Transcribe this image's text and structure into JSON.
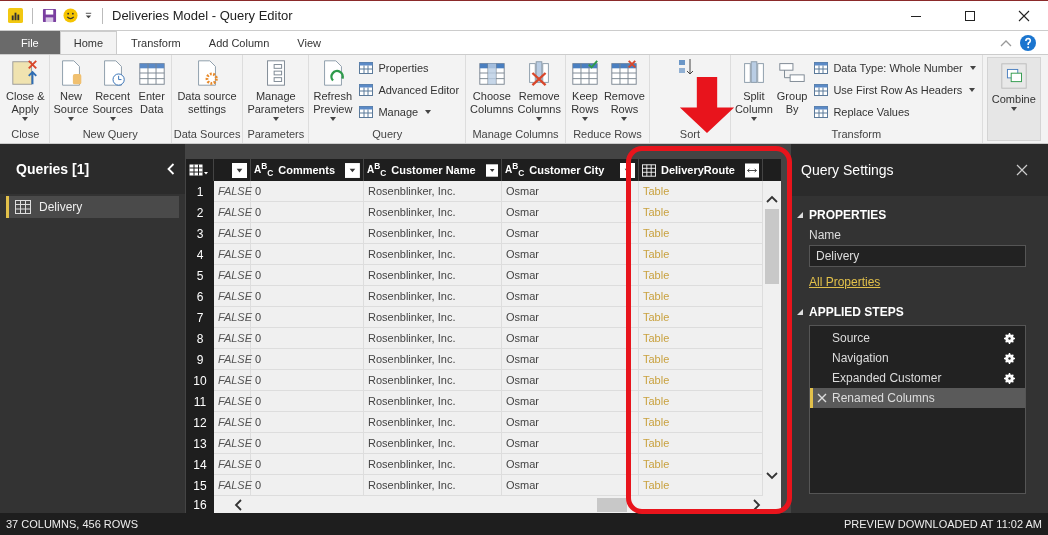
{
  "window": {
    "title": "Deliveries Model - Query Editor"
  },
  "tabs": [
    {
      "label": "File",
      "kind": "file",
      "selected": false
    },
    {
      "label": "Home",
      "kind": "tab",
      "selected": true
    },
    {
      "label": "Transform",
      "kind": "tab",
      "selected": false
    },
    {
      "label": "Add Column",
      "kind": "tab",
      "selected": false
    },
    {
      "label": "View",
      "kind": "tab",
      "selected": false
    }
  ],
  "ribbon": [
    {
      "name": "Close",
      "buttons": [
        {
          "kind": "large",
          "label": "Close &\nApply",
          "dropdown": true
        }
      ]
    },
    {
      "name": "New Query",
      "buttons": [
        {
          "kind": "large",
          "label": "New\nSource",
          "dropdown": true
        },
        {
          "kind": "large",
          "label": "Recent\nSources",
          "dropdown": true
        },
        {
          "kind": "large",
          "label": "Enter\nData",
          "dropdown": false
        }
      ]
    },
    {
      "name": "Data Sources",
      "buttons": [
        {
          "kind": "large",
          "label": "Data source\nsettings",
          "dropdown": false
        }
      ]
    },
    {
      "name": "Parameters",
      "buttons": [
        {
          "kind": "large",
          "label": "Manage\nParameters",
          "dropdown": true
        }
      ]
    },
    {
      "name": "Query",
      "buttons": [
        {
          "kind": "large",
          "label": "Refresh\nPreview",
          "dropdown": true
        },
        {
          "kind": "small",
          "label": "Properties",
          "dropdown": false
        },
        {
          "kind": "small",
          "label": "Advanced Editor",
          "dropdown": false
        },
        {
          "kind": "small",
          "label": "Manage",
          "dropdown": true
        }
      ]
    },
    {
      "name": "Manage Columns",
      "buttons": [
        {
          "kind": "large",
          "label": "Choose\nColumns",
          "dropdown": false
        },
        {
          "kind": "large",
          "label": "Remove\nColumns",
          "dropdown": true
        }
      ]
    },
    {
      "name": "Reduce Rows",
      "buttons": [
        {
          "kind": "large",
          "label": "Keep\nRows",
          "dropdown": true
        },
        {
          "kind": "large",
          "label": "Remove\nRows",
          "dropdown": true
        }
      ]
    },
    {
      "name": "Sort",
      "buttons": [
        {
          "kind": "icon"
        }
      ]
    },
    {
      "name": "Transform",
      "buttons": [
        {
          "kind": "large",
          "label": "Split\nColumn",
          "dropdown": true
        },
        {
          "kind": "large",
          "label": "Group\nBy",
          "dropdown": false
        },
        {
          "kind": "small",
          "label": "Data Type: Whole Number",
          "dropdown": true
        },
        {
          "kind": "small",
          "label": "Use First Row As Headers",
          "dropdown": true
        },
        {
          "kind": "small",
          "label": "Replace Values",
          "dropdown": false
        }
      ]
    },
    {
      "buttons": [
        {
          "kind": "large",
          "label": "Combine",
          "dropdown": true
        }
      ]
    }
  ],
  "queries": {
    "title": "Queries [1]",
    "items": [
      {
        "label": "Delivery",
        "selected": true
      }
    ]
  },
  "table": {
    "columns": [
      {
        "kind": "plain"
      },
      {
        "label": "Comments",
        "kind": "text",
        "type_label": "A$^{B}$$_{C}$"
      },
      {
        "label": "Customer Name",
        "kind": "text",
        "type_label": "A$^{B}$$_{C}$"
      },
      {
        "label": "Customer City",
        "kind": "text",
        "type_label": "A$^{B}$$_{C}$"
      },
      {
        "label": "DeliveryRoute",
        "kind": "table"
      }
    ],
    "rows": [
      {
        "n": "1",
        "cells": [
          "FALSE",
          "0",
          "Rosenblinker, Inc.",
          "Osmar",
          "Table"
        ]
      },
      {
        "n": "2",
        "cells": [
          "FALSE",
          "0",
          "Rosenblinker, Inc.",
          "Osmar",
          "Table"
        ]
      },
      {
        "n": "3",
        "cells": [
          "FALSE",
          "0",
          "Rosenblinker, Inc.",
          "Osmar",
          "Table"
        ]
      },
      {
        "n": "4",
        "cells": [
          "FALSE",
          "0",
          "Rosenblinker, Inc.",
          "Osmar",
          "Table"
        ]
      },
      {
        "n": "5",
        "cells": [
          "FALSE",
          "0",
          "Rosenblinker, Inc.",
          "Osmar",
          "Table"
        ]
      },
      {
        "n": "6",
        "cells": [
          "FALSE",
          "0",
          "Rosenblinker, Inc.",
          "Osmar",
          "Table"
        ]
      },
      {
        "n": "7",
        "cells": [
          "FALSE",
          "0",
          "Rosenblinker, Inc.",
          "Osmar",
          "Table"
        ]
      },
      {
        "n": "8",
        "cells": [
          "FALSE",
          "0",
          "Rosenblinker, Inc.",
          "Osmar",
          "Table"
        ]
      },
      {
        "n": "9",
        "cells": [
          "FALSE",
          "0",
          "Rosenblinker, Inc.",
          "Osmar",
          "Table"
        ]
      },
      {
        "n": "10",
        "cells": [
          "FALSE",
          "0",
          "Rosenblinker, Inc.",
          "Osmar",
          "Table"
        ]
      },
      {
        "n": "11",
        "cells": [
          "FALSE",
          "0",
          "Rosenblinker, Inc.",
          "Osmar",
          "Table"
        ]
      },
      {
        "n": "12",
        "cells": [
          "FALSE",
          "0",
          "Rosenblinker, Inc.",
          "Osmar",
          "Table"
        ]
      },
      {
        "n": "13",
        "cells": [
          "FALSE",
          "0",
          "Rosenblinker, Inc.",
          "Osmar",
          "Table"
        ]
      },
      {
        "n": "14",
        "cells": [
          "FALSE",
          "0",
          "Rosenblinker, Inc.",
          "Osmar",
          "Table"
        ]
      },
      {
        "n": "15",
        "cells": [
          "FALSE",
          "0",
          "Rosenblinker, Inc.",
          "Osmar",
          "Table"
        ]
      }
    ],
    "last_row_number": "16"
  },
  "settings": {
    "title": "Query Settings",
    "properties_heading": "PROPERTIES",
    "name_label": "Name",
    "name_value": "Delivery",
    "link": "All Properties",
    "steps_heading": "APPLIED STEPS",
    "steps": [
      {
        "label": "Source",
        "settings": true,
        "selected": false
      },
      {
        "label": "Navigation",
        "settings": true,
        "selected": false
      },
      {
        "label": "Expanded Customer",
        "settings": true,
        "selected": false
      },
      {
        "label": "Renamed Columns",
        "settings": false,
        "selected": true
      }
    ]
  },
  "status_bar": {
    "left": "37 COLUMNS, 456 ROWS",
    "right": "PREVIEW DOWNLOADED AT 11:02 AM"
  }
}
